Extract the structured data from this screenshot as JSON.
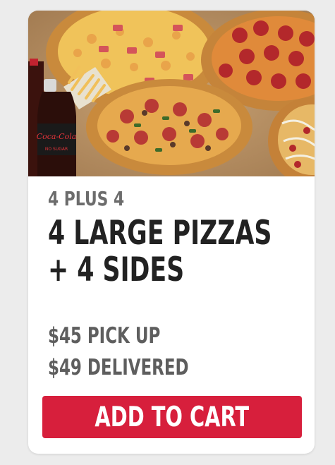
{
  "deal": {
    "eyebrow": "4 PLUS 4",
    "headline_line1": "4 LARGE PIZZAS",
    "headline_line2": "+ 4 SIDES",
    "price_pickup": "$45 PICK UP",
    "price_delivered": "$49 DELIVERED",
    "cta_label": "ADD TO CART"
  },
  "image": {
    "bottle_logo": "Coca-Cola",
    "bottle_sub": "NO SUGAR"
  },
  "colors": {
    "cta": "#d71f3c",
    "headline": "#222222",
    "eyebrow": "#6c6c6c",
    "price": "#5e5e5e",
    "background": "#ececec",
    "card": "#ffffff"
  }
}
